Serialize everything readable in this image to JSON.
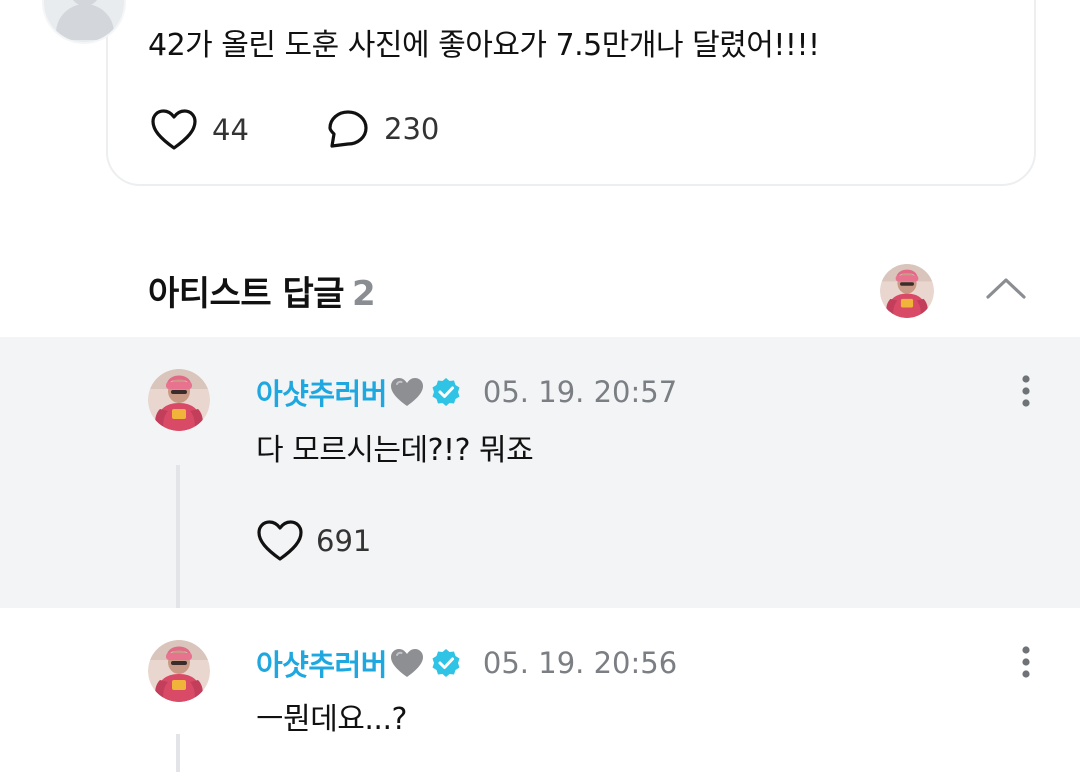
{
  "post": {
    "text": "42가 올린 도훈 사진에 좋아요가 7.5만개나 달렸어!!!!",
    "like_count": "44",
    "comment_count": "230"
  },
  "artist_replies": {
    "title": "아티스트 답글",
    "count": "2"
  },
  "replies": [
    {
      "author": "아샷추러버",
      "timestamp": "05. 19. 20:57",
      "text": "다 모르시는데?!? 뭐죠",
      "like_count": "691"
    },
    {
      "author": "아샷추러버",
      "timestamp": "05. 19. 20:56",
      "text": "ㅡ뭔데요...?"
    }
  ],
  "colors": {
    "author": "#1fa8e0",
    "verified": "#2fc3e6",
    "reply_bg": "#f3f4f6",
    "muted": "#7b7f84"
  },
  "icons": {
    "like": "heart-outline-icon",
    "comment": "speech-bubble-icon",
    "verified": "verified-badge-icon",
    "author_suffix": "gray-heart-icon",
    "more": "vertical-dots-icon",
    "collapse": "chevron-up-icon"
  }
}
